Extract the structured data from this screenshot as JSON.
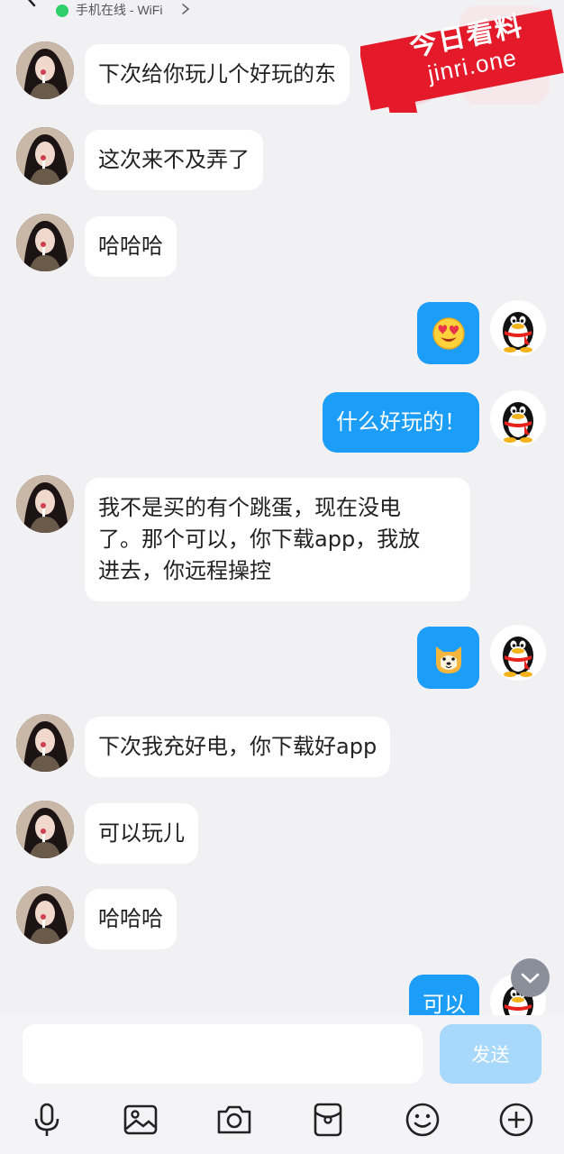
{
  "header": {
    "status_text": "手机在线 - WiFi",
    "status_color": "#2fd06b"
  },
  "watermark": {
    "line1": "今日看料",
    "line2": "jinri.one"
  },
  "messages": [
    {
      "side": "left",
      "text": "下次给你玩儿个好玩的东"
    },
    {
      "side": "left",
      "text": "这次来不及弄了"
    },
    {
      "side": "left",
      "text": "哈哈哈"
    },
    {
      "side": "right",
      "type": "emoji",
      "icon": "heart-eyes-emoji"
    },
    {
      "side": "right",
      "text": "什么好玩的！"
    },
    {
      "side": "left",
      "lines": [
        "我不是买的有个跳蛋，现在没电",
        "了。那个可以，你下载app，我放",
        "进去，你远程操控"
      ]
    },
    {
      "side": "right",
      "type": "emoji",
      "icon": "shiba-dog-emoji"
    },
    {
      "side": "left",
      "text": "下次我充好电，你下载好app"
    },
    {
      "side": "left",
      "text": "可以玩儿"
    },
    {
      "side": "left",
      "text": "哈哈哈"
    },
    {
      "side": "right",
      "text": "可以"
    }
  ],
  "input": {
    "placeholder": "",
    "send_label": "发送"
  },
  "toolbar": {
    "icons": [
      "microphone-icon",
      "image-icon",
      "camera-icon",
      "red-packet-icon",
      "emoji-icon",
      "plus-icon"
    ]
  },
  "colors": {
    "accent": "#1b9df8",
    "background": "#f1f1f3",
    "send_disabled": "#a8d8fb"
  }
}
